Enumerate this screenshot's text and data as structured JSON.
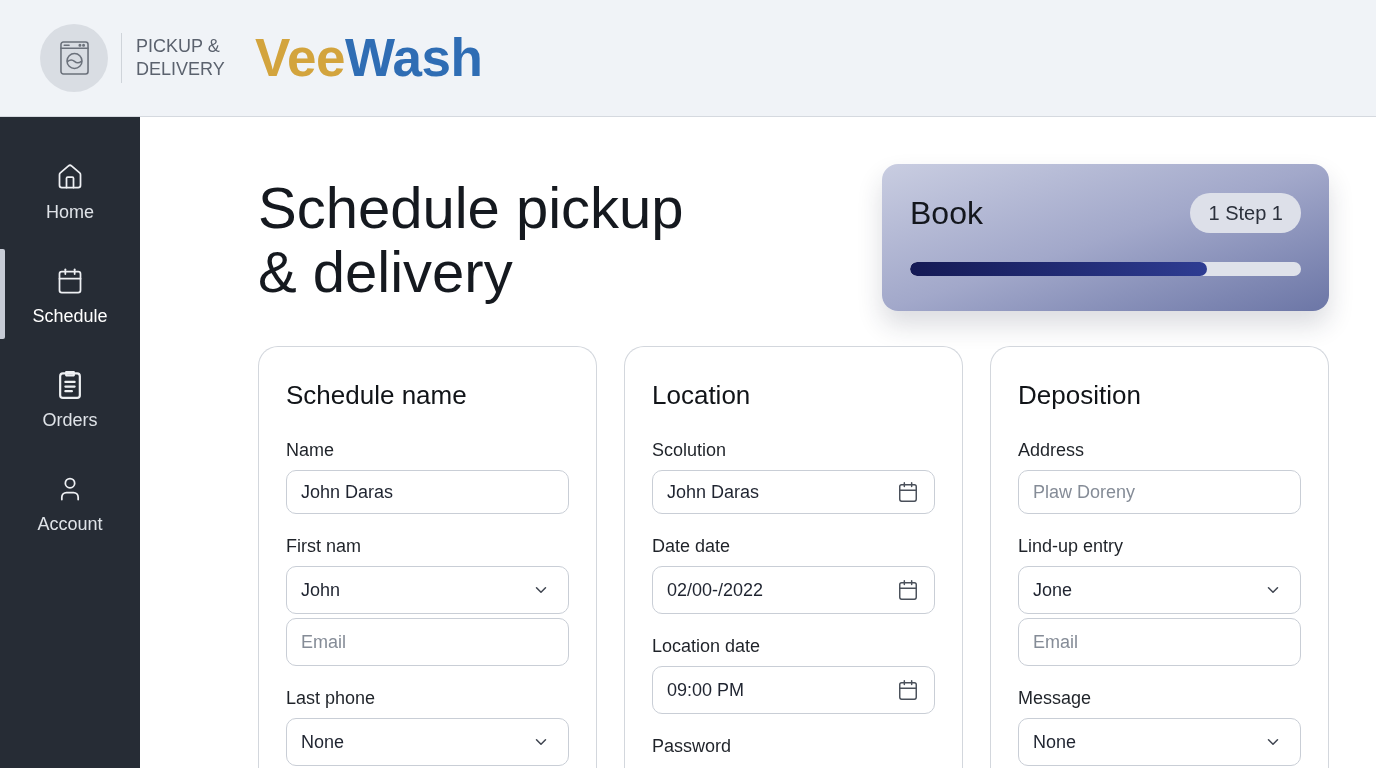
{
  "header": {
    "tagline": "PICKUP & DELIVERY",
    "brand_parts": [
      "Vee",
      "Wash"
    ]
  },
  "sidebar": {
    "items": [
      {
        "label": "Home",
        "selected": false
      },
      {
        "label": "Schedule",
        "selected": true
      },
      {
        "label": "Orders",
        "selected": false
      },
      {
        "label": "Account",
        "selected": false
      }
    ]
  },
  "page_title": "Schedule pickup & delivery",
  "booking_card": {
    "title": "Book",
    "step_badge": "1 Step 1",
    "progress": {
      "level": 0.76
    }
  },
  "sections": [
    {
      "title": "Schedule name",
      "fields": [
        {
          "kind": "text",
          "label": "Name",
          "value": "John Daras"
        },
        {
          "kind": "select",
          "label": "First nam",
          "value": "John"
        },
        {
          "kind": "text",
          "placeholder": "Email"
        },
        {
          "kind": "select",
          "label": "Last phone",
          "value": "None"
        }
      ]
    },
    {
      "title": "Location",
      "fields": [
        {
          "kind": "date",
          "label": "Scolution",
          "value": "John Daras"
        },
        {
          "kind": "date",
          "label": "Date date",
          "value": "02/00-/2022"
        },
        {
          "kind": "date",
          "label": "Location date",
          "value": "09:00 PM"
        },
        {
          "kind": "label",
          "label": "Password"
        }
      ]
    },
    {
      "title": "Deposition",
      "fields": [
        {
          "kind": "text",
          "label": "Address",
          "placeholder": "Plaw Doreny"
        },
        {
          "kind": "select",
          "label": "Lind-up entry",
          "value": "Jone"
        },
        {
          "kind": "text",
          "placeholder": "Email"
        },
        {
          "kind": "select",
          "label": "Message",
          "value": "None"
        }
      ]
    }
  ]
}
